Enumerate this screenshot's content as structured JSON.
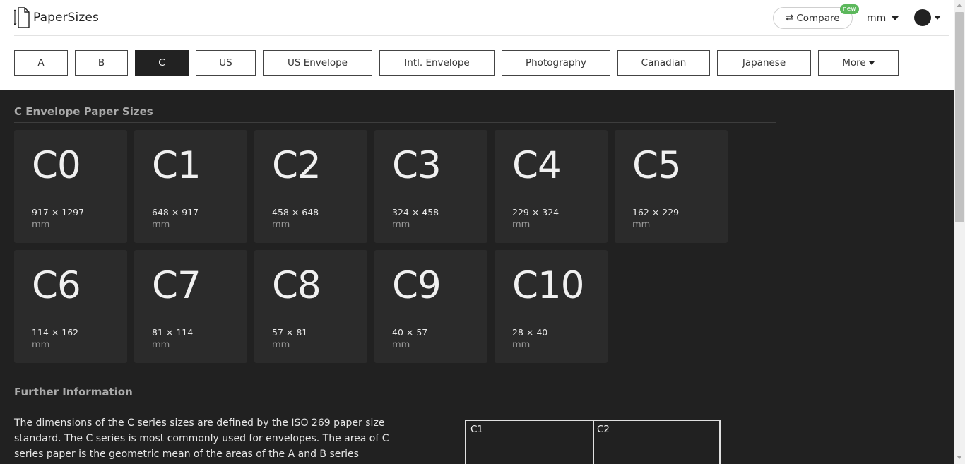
{
  "brand": {
    "name": "PaperSizes",
    "logo_icon": "paper-sizes-logo-icon"
  },
  "header": {
    "compare_label": "Compare",
    "compare_icon": "swap-arrows-icon",
    "compare_badge": "new",
    "unit": "mm",
    "theme_icon": "dark-theme-dot-icon"
  },
  "tabs": [
    {
      "label": "A",
      "active": false
    },
    {
      "label": "B",
      "active": false
    },
    {
      "label": "C",
      "active": true
    },
    {
      "label": "US",
      "active": false
    },
    {
      "label": "US Envelope",
      "active": false
    },
    {
      "label": "Intl. Envelope",
      "active": false
    },
    {
      "label": "Photography",
      "active": false
    },
    {
      "label": "Canadian",
      "active": false
    },
    {
      "label": "Japanese",
      "active": false
    },
    {
      "label": "More",
      "active": false,
      "icon": "chevron-down-icon"
    }
  ],
  "section": {
    "title": "C Envelope Paper Sizes"
  },
  "sizes": [
    {
      "name": "C0",
      "dims": "917 × 1297",
      "unit": "mm"
    },
    {
      "name": "C1",
      "dims": "648 × 917",
      "unit": "mm"
    },
    {
      "name": "C2",
      "dims": "458 × 648",
      "unit": "mm"
    },
    {
      "name": "C3",
      "dims": "324 × 458",
      "unit": "mm"
    },
    {
      "name": "C4",
      "dims": "229 × 324",
      "unit": "mm"
    },
    {
      "name": "C5",
      "dims": "162 × 229",
      "unit": "mm"
    },
    {
      "name": "C6",
      "dims": "114 × 162",
      "unit": "mm"
    },
    {
      "name": "C7",
      "dims": "81 × 114",
      "unit": "mm"
    },
    {
      "name": "C8",
      "dims": "57 × 81",
      "unit": "mm"
    },
    {
      "name": "C9",
      "dims": "40 × 57",
      "unit": "mm"
    },
    {
      "name": "C10",
      "dims": "28 × 40",
      "unit": "mm"
    }
  ],
  "further": {
    "title": "Further Information",
    "text": "The dimensions of the C series sizes are defined by the ISO 269 paper size standard. The C series is most commonly used for envelopes. The area of C series paper is the geometric mean of the areas of the A and B series",
    "diagram_labels": [
      "C1",
      "C2"
    ]
  },
  "colors": {
    "page_bg": "#212121",
    "card_bg": "#2b2b2b",
    "active_tab": "#222222",
    "badge": "#5cb85c"
  }
}
